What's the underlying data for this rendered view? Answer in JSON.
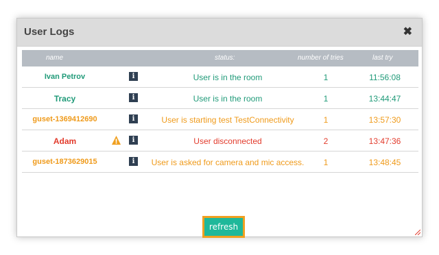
{
  "dialog": {
    "title": "User Logs",
    "close_glyph": "✖"
  },
  "columns": {
    "name": "name",
    "status": "status:",
    "tries": "number of tries",
    "last": "last try"
  },
  "rows": [
    {
      "name": "Ivan Petrov",
      "status": "User is in the room",
      "tries": "1",
      "last": "11:56:08",
      "color": "#1f9a78",
      "warning": false
    },
    {
      "name": "Tracy",
      "status": "User is in the room",
      "tries": "1",
      "last": "13:44:47",
      "color": "#1f9a78",
      "warning": false
    },
    {
      "name": "guset-1369412690",
      "status": "User is starting test TestConnectivity",
      "tries": "1",
      "last": "13:57:30",
      "color": "#ef9a1a",
      "warning": false
    },
    {
      "name": "Adam",
      "status": "User disconnected",
      "tries": "2",
      "last": "13:47:36",
      "color": "#e23b2c",
      "warning": true
    },
    {
      "name": "guset-1873629015",
      "status": "User is asked for camera and mic access.",
      "tries": "1",
      "last": "13:48:45",
      "color": "#ef9a1a",
      "warning": false
    }
  ],
  "info_glyph": "i",
  "refresh_label": "refresh",
  "icons": {
    "info": "info-icon",
    "warning": "warning-icon",
    "close": "close-icon",
    "resize": "resize-handle-icon"
  }
}
